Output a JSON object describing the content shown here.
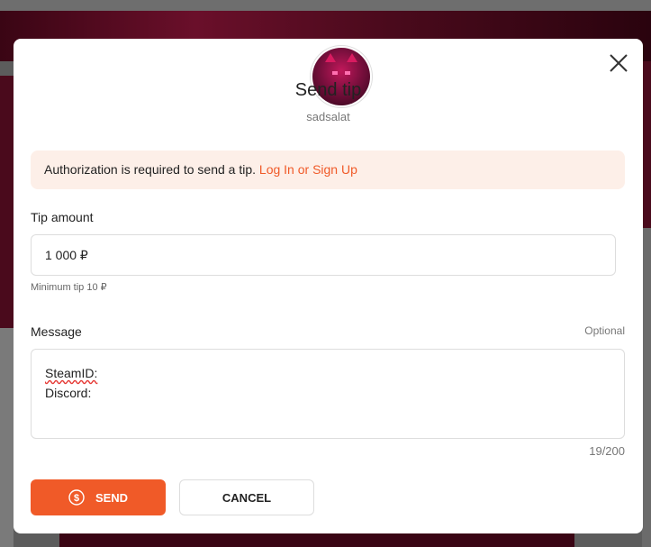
{
  "modal": {
    "title": "Send tip",
    "recipient": "sadsalat",
    "alert": {
      "text": "Authorization is required to send a tip.",
      "link": "Log In or Sign Up"
    },
    "amount": {
      "label": "Tip amount",
      "value": "1 000 ₽",
      "hint": "Minimum tip 10 ₽"
    },
    "message": {
      "label": "Message",
      "optional": "Optional",
      "lines": [
        "SteamID:",
        "Discord:"
      ],
      "counter": "19/200"
    },
    "buttons": {
      "send": "SEND",
      "cancel": "CANCEL"
    },
    "icons": {
      "close": "close-icon",
      "send": "coin-icon"
    },
    "colors": {
      "accent": "#f05a28",
      "alert_bg": "#fdefe8"
    }
  }
}
